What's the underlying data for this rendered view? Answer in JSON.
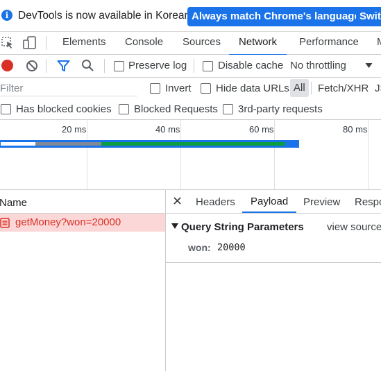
{
  "infobar": {
    "icon": "info-icon",
    "message": "DevTools is now available in Korean!",
    "primary_button": "Always match Chrome's language",
    "secondary_button": "Switc"
  },
  "tabs": {
    "items": [
      "Elements",
      "Console",
      "Sources",
      "Network",
      "Performance",
      "M"
    ],
    "active": "Network"
  },
  "toolbar": {
    "preserve_log": "Preserve log",
    "disable_cache": "Disable cache",
    "throttling": "No throttling"
  },
  "filter": {
    "placeholder": "Filter",
    "invert": "Invert",
    "hide_data_urls": "Hide data URLs",
    "types": [
      "All",
      "Fetch/XHR",
      "JS"
    ]
  },
  "blocked": {
    "has_blocked_cookies": "Has blocked cookies",
    "blocked_requests": "Blocked Requests",
    "third_party": "3rd-party requests"
  },
  "overview": {
    "ticks": [
      "20 ms",
      "40 ms",
      "60 ms",
      "80 ms"
    ]
  },
  "requests": {
    "column_name": "Name",
    "items": [
      {
        "name": "getMoney?won=20000",
        "status": "failed"
      }
    ]
  },
  "details": {
    "tabs": [
      "Headers",
      "Payload",
      "Preview",
      "Respo"
    ],
    "active_tab": "Payload",
    "section_title": "Query String Parameters",
    "view_source": "view source",
    "params": [
      {
        "key": "won:",
        "value": "20000"
      }
    ]
  },
  "colors": {
    "accent": "#1a73e8",
    "error_row_bg": "#fcd7d7",
    "error_text": "#d93025",
    "record_red": "#d93025",
    "waterfall_green": "#0a9e3f",
    "waterfall_gray": "#7f8a99"
  }
}
